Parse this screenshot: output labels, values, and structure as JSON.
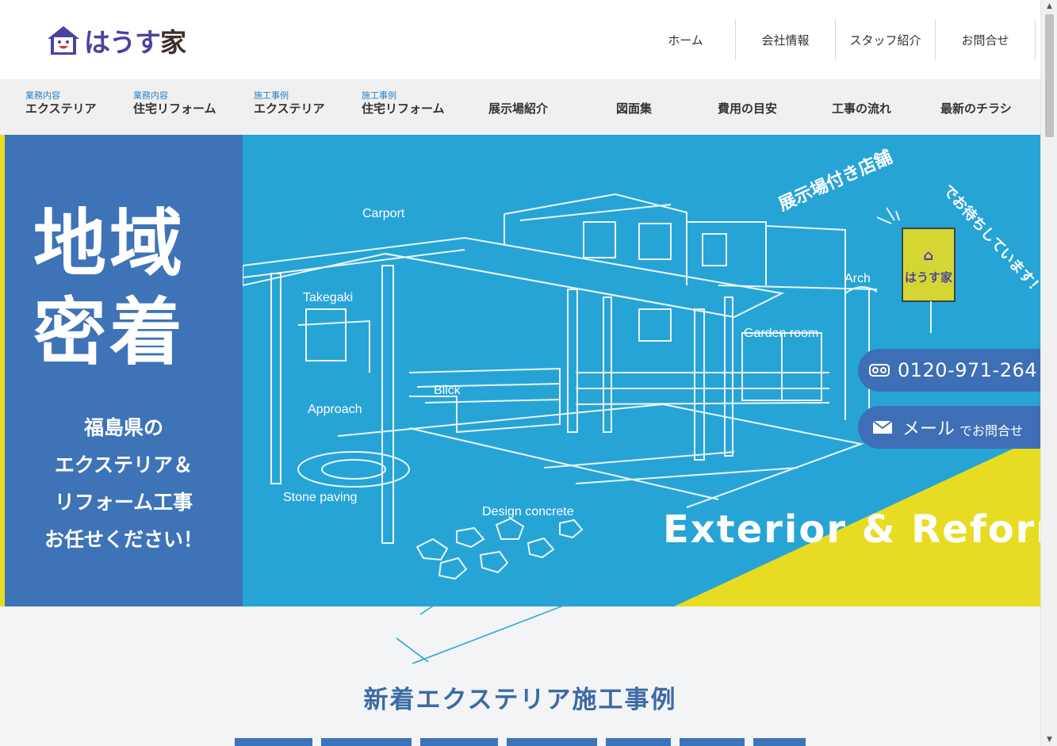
{
  "header": {
    "logo": {
      "text_hira": "はうす",
      "text_kanji": "家"
    },
    "nav": [
      {
        "label": "ホーム"
      },
      {
        "label": "会社情報"
      },
      {
        "label": "スタッフ紹介"
      },
      {
        "label": "お問合せ"
      }
    ]
  },
  "menu": [
    {
      "small": "業務内容",
      "label": "エクステリア"
    },
    {
      "small": "業務内容",
      "label": "住宅リフォーム"
    },
    {
      "small": "施工事例",
      "label": "エクステリア"
    },
    {
      "small": "施工事例",
      "label": "住宅リフォーム"
    },
    {
      "small": "",
      "label": "展示場紹介"
    },
    {
      "small": "",
      "label": "図面集"
    },
    {
      "small": "",
      "label": "費用の目安"
    },
    {
      "small": "",
      "label": "工事の流れ"
    },
    {
      "small": "",
      "label": "最新のチラシ"
    }
  ],
  "hero": {
    "headline_1": "地域",
    "headline_2": "密着",
    "sub_1": "福島県の",
    "sub_2": "エクステリア＆",
    "sub_3": "リフォーム工事",
    "sub_4": "お任せください！",
    "sketch_labels": {
      "carport": "Carport",
      "takegaki": "Takegaki",
      "arch": "Arch",
      "garden_room": "Garden room",
      "blick": "Blick",
      "approach": "Approach",
      "stone_paving": "Stone paving",
      "design_concrete": "Design concrete"
    },
    "sign_text": "はうす家",
    "arc_text_1": "展示場付き店舗",
    "arc_text_2": "でお待ちしています！",
    "tagline": "Exterior & Reform",
    "phone_number": "0120-971-264",
    "mail_main": "メール",
    "mail_sub": "でお問合せ",
    "colors": {
      "blue_left": "#3e73b8",
      "sky": "#27a4d6",
      "yellow": "#e8dc22"
    }
  },
  "section": {
    "title": "新着エクステリア施工事例"
  }
}
